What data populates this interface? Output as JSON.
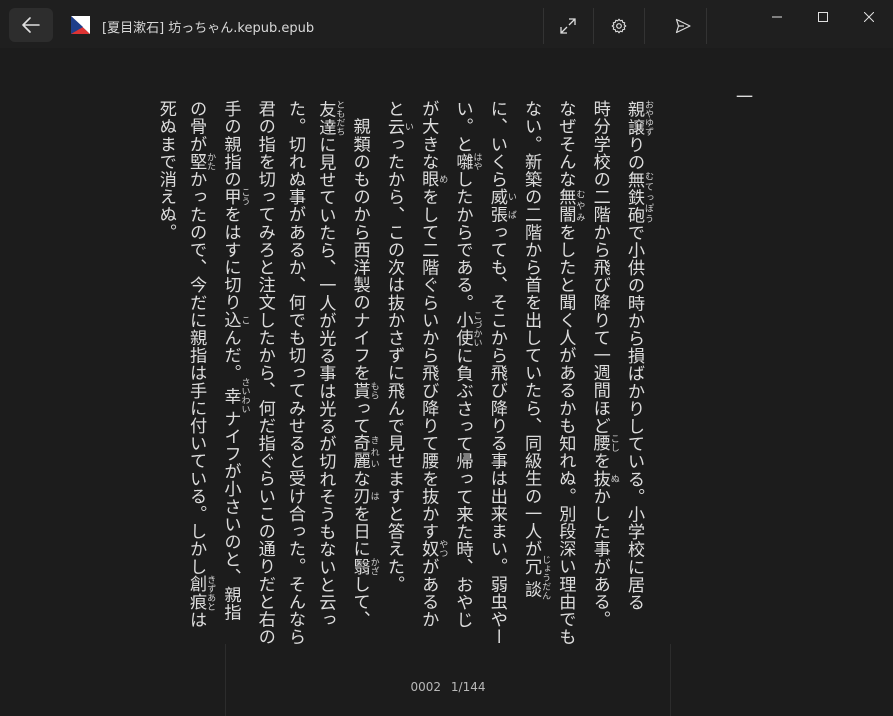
{
  "window": {
    "title": "[夏目漱石] 坊っちゃん.kepub.epub"
  },
  "toolbar": {
    "back_icon": "arrow-left-icon",
    "fullscreen_icon": "expand-arrows-icon",
    "settings_icon": "gear-icon",
    "share_icon": "send-icon"
  },
  "content": {
    "chapter_mark": "一",
    "lines": [
      [
        [
          "親",
          "おや"
        ],
        [
          "譲",
          "ゆず"
        ],
        "りの",
        [
          "無鉄砲",
          "むてっぽう"
        ],
        "で小供の時から損ばかりしている。小学校に居る"
      ],
      [
        "時分学校の二階から飛び降りて一週間ほど",
        [
          "腰",
          "こし"
        ],
        "を",
        [
          "抜",
          "ぬ"
        ],
        "かした事がある。"
      ],
      [
        "なぜそんな",
        [
          "無闇",
          "むやみ"
        ],
        "をしたと聞く人があるかも知れぬ。別段深い理由でも"
      ],
      [
        "ない。新築の二階から首を出していたら、同級生の一人が",
        [
          "冗談",
          "じょうだん"
        ]
      ],
      [
        "に、いくら",
        [
          "威張",
          "いば"
        ],
        "っても、そこから飛び降りる事は出来まい。弱虫やー"
      ],
      [
        "い。と",
        [
          "囃",
          "はや"
        ],
        "したからである。",
        [
          "小使",
          "こづかい"
        ],
        "に負ぶさって帰って来た時、おやじ"
      ],
      [
        "が大きな",
        [
          "眼",
          "め"
        ],
        "をして二階ぐらいから飛び降りて腰を抜かす",
        [
          "奴",
          "やつ"
        ],
        "があるか"
      ],
      [
        "と",
        [
          "云",
          "い"
        ],
        "ったから、この次は抜かさずに飛んで見せますと答えた。"
      ],
      [
        "　親類のものから西洋製のナイフを",
        [
          "貰",
          "もら"
        ],
        "って",
        [
          "奇麗",
          "きれい"
        ],
        "な",
        [
          "刃",
          "は"
        ],
        "を日に",
        [
          "翳",
          "かざ"
        ],
        "して、"
      ],
      [
        [
          "友達",
          "ともだち"
        ],
        "に見せていたら、一人が光る事は光るが切れそうもないと云っ"
      ],
      [
        "た。切れぬ事があるか、何でも切ってみせると受け合った。そんなら"
      ],
      [
        "君の指を切ってみろと注文したから、何だ指ぐらいこの通りだと右の"
      ],
      [
        "手の親指の",
        [
          "甲",
          "こう"
        ],
        "をはすに切り",
        [
          "込",
          "こ"
        ],
        "んだ。",
        [
          "幸",
          "さいわい"
        ],
        "ナイフが小さいのと、親指"
      ],
      [
        "の骨が",
        [
          "堅",
          "かた"
        ],
        "かったので、今だに親指は手に付いている。しかし",
        [
          "創痕",
          "きずあと"
        ],
        "は"
      ],
      [
        "死ぬまで消えぬ。"
      ]
    ]
  },
  "footer": {
    "position": "0002",
    "page": "1/144"
  }
}
